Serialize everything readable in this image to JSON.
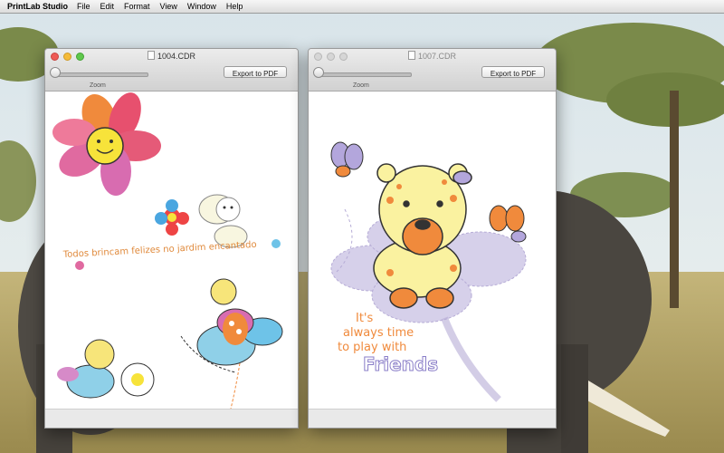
{
  "menubar": {
    "app_name": "PrintLab Studio",
    "items": [
      "File",
      "Edit",
      "Format",
      "View",
      "Window",
      "Help"
    ]
  },
  "windows": [
    {
      "title": "1004.CDR",
      "zoom_label": "Zoom",
      "export_label": "Export to PDF",
      "artwork_text": "Todos brincam felizes no jardim encantado"
    },
    {
      "title": "1007.CDR",
      "zoom_label": "Zoom",
      "export_label": "Export to PDF",
      "artwork_text": [
        "It's",
        "always time",
        "to play with",
        "Friends"
      ]
    }
  ],
  "colors": {
    "traffic_close": "#ee5b55",
    "traffic_minimize": "#f5bb39",
    "traffic_zoom": "#5fc84c"
  }
}
